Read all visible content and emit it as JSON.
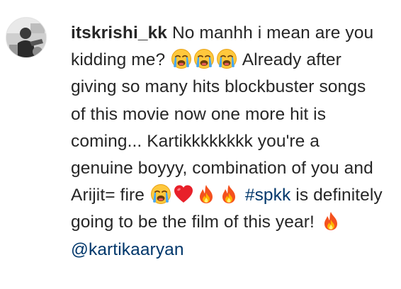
{
  "comment": {
    "username": "itskrishi_kk",
    "text_1": "No manhh i mean are you kidding me?",
    "text_2": "Already after giving so many hits blockbuster songs of this movie now one more hit is coming... Kartikkkkkkkk you're a genuine boyyy, combination of you and Arijit= fire",
    "hashtag": "#spkk",
    "text_3": "is definitely going to be the film of this year!",
    "mention": "@kartikaaryan"
  },
  "icons": {
    "avatar": "user-avatar-photo",
    "crying": "loudly-crying-face-emoji",
    "heart": "red-heart-emoji",
    "fire": "fire-emoji"
  },
  "colors": {
    "text": "#262626",
    "link": "#00376b",
    "background": "#ffffff"
  }
}
